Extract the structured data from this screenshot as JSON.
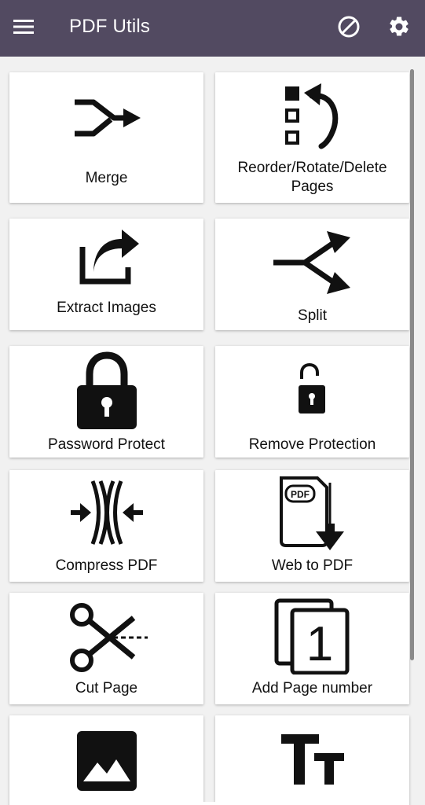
{
  "appbar": {
    "title": "PDF Utils",
    "menu_icon": "hamburger-menu-icon",
    "block_icon": "block-circle-icon",
    "settings_icon": "gear-icon",
    "background": "#524a61"
  },
  "tools": [
    {
      "label": "Merge",
      "icon": "merge-arrow-icon"
    },
    {
      "label": "Reorder/Rotate/Delete Pages",
      "icon": "reorder-rotate-icon"
    },
    {
      "label": "Extract Images",
      "icon": "share-export-icon"
    },
    {
      "label": "Split",
      "icon": "split-arrow-icon"
    },
    {
      "label": "Password Protect",
      "icon": "lock-icon"
    },
    {
      "label": "Remove Protection",
      "icon": "unlock-icon"
    },
    {
      "label": "Compress PDF",
      "icon": "compress-icon"
    },
    {
      "label": "Web to PDF",
      "icon": "pdf-download-icon"
    },
    {
      "label": "Cut Page",
      "icon": "scissors-icon"
    },
    {
      "label": "Add Page number",
      "icon": "page-number-icon"
    },
    {
      "label": "",
      "icon": "image-icon"
    },
    {
      "label": "",
      "icon": "text-size-icon"
    }
  ]
}
